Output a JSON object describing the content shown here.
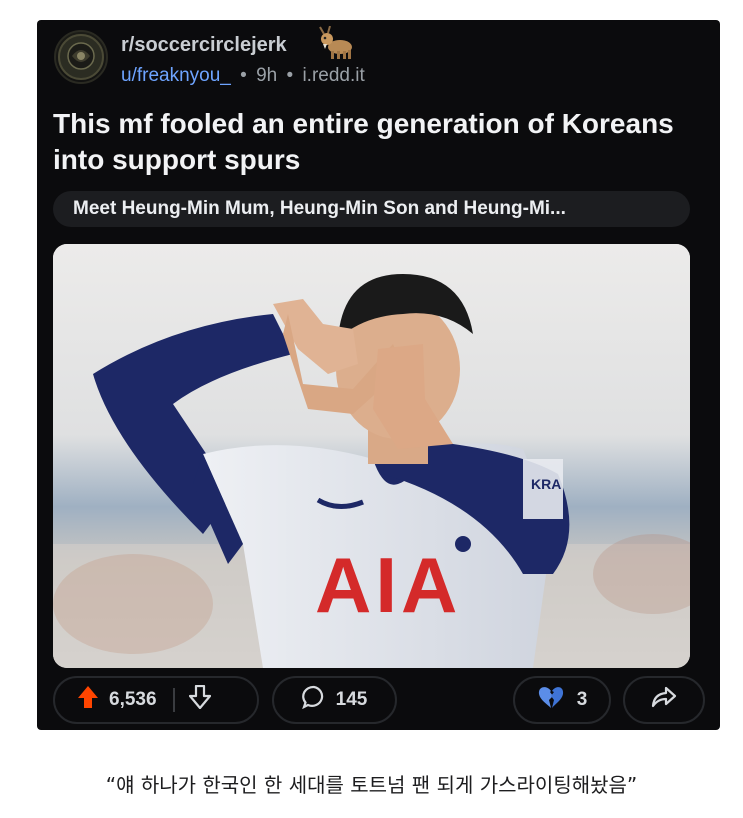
{
  "post": {
    "subreddit": "r/soccercirclejerk",
    "author": "u/freaknyou_",
    "age": "9h",
    "domain": "i.redd.it",
    "title": "This mf fooled an entire generation of Koreans into support spurs",
    "caption_pill": "Meet Heung-Min Mum, Heung-Min Son and Heung-Mi...",
    "image": {
      "shirt_text": "AIA",
      "sleeve_text": "KRA"
    }
  },
  "actions": {
    "upvotes": "6,536",
    "comments": "145",
    "awards": "3"
  },
  "icons": {
    "upvote": "upvote-arrow-icon",
    "downvote": "downvote-arrow-icon",
    "comment": "comment-bubble-icon",
    "award": "broken-heart-icon",
    "share": "share-arrow-icon"
  },
  "colors": {
    "post_bg": "#0b0b0d",
    "upvote_orange": "#ff4500",
    "author_blue": "#6ea4ff",
    "award_blue": "#5b8de8",
    "shirt_red": "#d42a2a",
    "shirt_navy": "#1e2a6b"
  },
  "korean_caption": "“얘 하나가 한국인 한 세대를 토트넘 팬 되게 가스라이팅해놨음”"
}
